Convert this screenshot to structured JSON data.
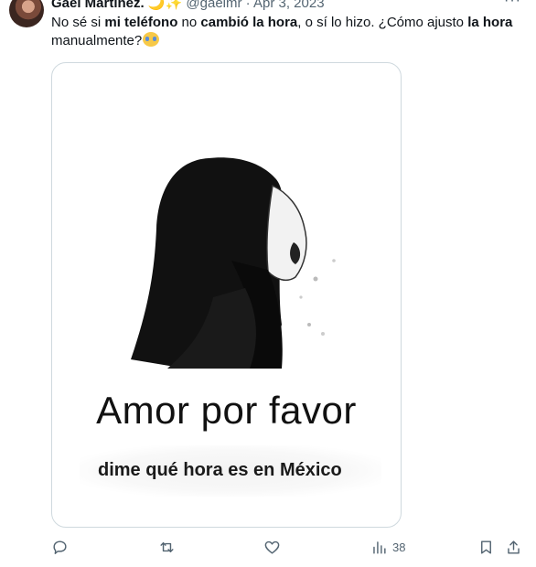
{
  "tweet": {
    "author_name": "Gael Martínez.",
    "author_name_emojis": "🌙✨",
    "handle": "@gaelmr",
    "date": "Apr 3, 2023",
    "more": "···",
    "text_parts": [
      {
        "t": "No sé si ",
        "b": false
      },
      {
        "t": "mi teléfono",
        "b": true
      },
      {
        "t": " no ",
        "b": false
      },
      {
        "t": "cambió la hora",
        "b": true
      },
      {
        "t": ", o sí lo hizo. ¿Cómo ajusto ",
        "b": false
      },
      {
        "t": "la hora",
        "b": true
      },
      {
        "t": " manualmente?",
        "b": false
      }
    ],
    "emoji": "crying-face",
    "media": {
      "caption_big": "Amor por favor",
      "caption_small": "dime qué hora es en México"
    },
    "actions": {
      "views": "38"
    }
  },
  "colors": {
    "text": "#0f1419",
    "muted": "#536471",
    "border": "#cfd9de"
  }
}
